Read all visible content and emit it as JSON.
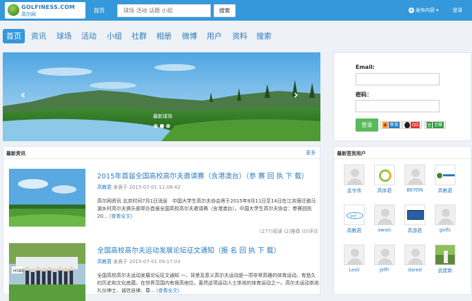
{
  "header": {
    "logo_line1": "GOLFINESS.COM",
    "logo_line2": "高尔网",
    "home_link": "首页",
    "search_placeholder": "球场 活动 话题 小组",
    "search_button": "搜索",
    "publish_label": "发布内容",
    "login_link": "登录"
  },
  "menu": {
    "items": [
      "首页",
      "资讯",
      "球场",
      "活动",
      "小组",
      "社群",
      "相册",
      "微博",
      "用户",
      "资料",
      "搜索"
    ],
    "active": "首页"
  },
  "carousel": {
    "caption": "最新球场",
    "slide_count": 3,
    "active_slide": 2
  },
  "login": {
    "email_label": "Email:",
    "password_label": "密码：",
    "submit": "登录",
    "social": [
      "新浪",
      "QQ",
      "豆瓣"
    ]
  },
  "news": {
    "title": "最新资讯",
    "more": "更多",
    "articles": [
      {
        "title": "2015年首届全国高校高尔夫邀请赛（含港澳台）（参 赛 回 执 下 载）",
        "author": "高教君",
        "date_text": "发表于 2015-07-01 11:08:42",
        "body": "高尔网资讯 北京时间7月1日消息　中国大学生高尔夫协会将于2015年8月11日至14日在江苏宿迁骆马湖乡村高尔夫俱乐部举办首届全国高校高尔夫邀请赛（含港澳台）。中国大学生高尔夫协会：参赛回执20...",
        "readmore": "(查看全文)",
        "stats": "(277)阅读 (2)推荐 (0)评论"
      },
      {
        "title": "全国高校高尔夫运动发展论坛征文通知（报 名 回 执 下 载）",
        "author": "高教君",
        "date_text": "发表于 2015-07-01 09:17:03",
        "body": "全国高校高尔夫运动发展论坛征文通知 一、背景及意义高尔夫运动是一项非常高雅的体育运动，有悠久的历史和文化底蕴，在世界范围内有很高地位，虽然这项运动人士崇尚的体育运动之一。高尔夫运动崇尚礼仪绅士、诚信自律、尊...",
        "readmore": "(查看全文)",
        "stats": ""
      }
    ]
  },
  "users": {
    "title": "最新签到用户",
    "list": [
      {
        "name": "孟令伟",
        "avatar": "default"
      },
      {
        "name": "高体君",
        "avatar": "logo"
      },
      {
        "name": "BEYON",
        "avatar": "default"
      },
      {
        "name": "高教君",
        "avatar": "golfiness"
      },
      {
        "name": "高教君",
        "avatar": "golf"
      },
      {
        "name": "awaic",
        "avatar": "default"
      },
      {
        "name": "高游君",
        "avatar": "screen"
      },
      {
        "name": "golfc",
        "avatar": "default"
      },
      {
        "name": "Lesli",
        "avatar": "default"
      },
      {
        "name": "Jeffr",
        "avatar": "default"
      },
      {
        "name": "dared",
        "avatar": "default"
      },
      {
        "name": "武建新",
        "avatar": "photo"
      }
    ]
  },
  "colors": {
    "primary": "#3498db",
    "link": "#2a7bbf",
    "login_button": "#5cb85c"
  }
}
